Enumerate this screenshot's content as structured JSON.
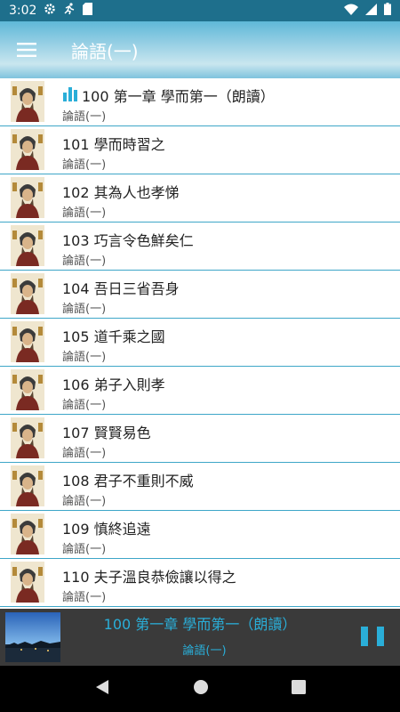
{
  "status_bar": {
    "time": "3:02"
  },
  "app_bar": {
    "title": "論語(一)"
  },
  "tracks": [
    {
      "title": "100 第一章 學而第一（朗讀）",
      "subtitle": "論語(一)",
      "playing": true
    },
    {
      "title": "101 學而時習之",
      "subtitle": "論語(一)"
    },
    {
      "title": "102 其為人也孝悌",
      "subtitle": "論語(一)"
    },
    {
      "title": "103 巧言令色鮮矣仁",
      "subtitle": "論語(一)"
    },
    {
      "title": "104 吾日三省吾身",
      "subtitle": "論語(一)"
    },
    {
      "title": "105 道千乘之國",
      "subtitle": "論語(一)"
    },
    {
      "title": "106 弟子入則孝",
      "subtitle": "論語(一)"
    },
    {
      "title": "107 賢賢易色",
      "subtitle": "論語(一)"
    },
    {
      "title": "108 君子不重則不威",
      "subtitle": "論語(一)"
    },
    {
      "title": "109 慎終追遠",
      "subtitle": "論語(一)"
    },
    {
      "title": "110 夫子溫良恭儉讓以得之",
      "subtitle": "論語(一)"
    }
  ],
  "player": {
    "title": "100 第一章 學而第一（朗讀）",
    "subtitle": "論語(一)"
  },
  "colors": {
    "accent": "#2aaed8",
    "divider": "#3ea6c8",
    "player_bg": "#3a3a3a"
  },
  "icons": [
    "gear-icon",
    "run-icon",
    "sd-card-icon",
    "wifi-icon",
    "signal-icon",
    "battery-icon",
    "menu-icon",
    "equalizer-icon",
    "pause-icon",
    "back-icon",
    "home-icon",
    "recents-icon"
  ]
}
